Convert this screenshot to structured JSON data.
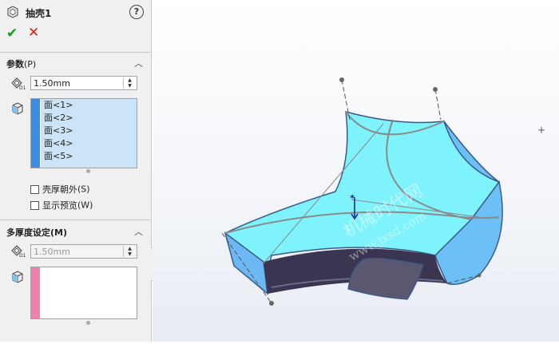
{
  "feature": {
    "title": "抽壳1",
    "help_glyph": "?"
  },
  "actions": {
    "ok": "✔",
    "cancel": "✕"
  },
  "params": {
    "header": "参数",
    "header_key": "(P)",
    "thickness": "1.50mm",
    "faces": [
      "面<1>",
      "面<2>",
      "面<3>",
      "面<4>",
      "面<5>"
    ],
    "shell_outward": "壳厚朝外",
    "shell_outward_key": "(S)",
    "show_preview": "显示预览",
    "show_preview_key": "(W)"
  },
  "multi": {
    "header": "多厚度设定",
    "header_key": "(M)",
    "thickness": "1.50mm",
    "faces": []
  },
  "watermark": {
    "line1": "机械时代网",
    "line2": "www.jxsd.com"
  },
  "colors": {
    "face_list_stripe": "#3a8ce6",
    "multi_list_stripe": "#f080b0",
    "part_face": "#7ff3fc",
    "part_side": "#6fb8f4",
    "selection": "#cce4f7"
  }
}
